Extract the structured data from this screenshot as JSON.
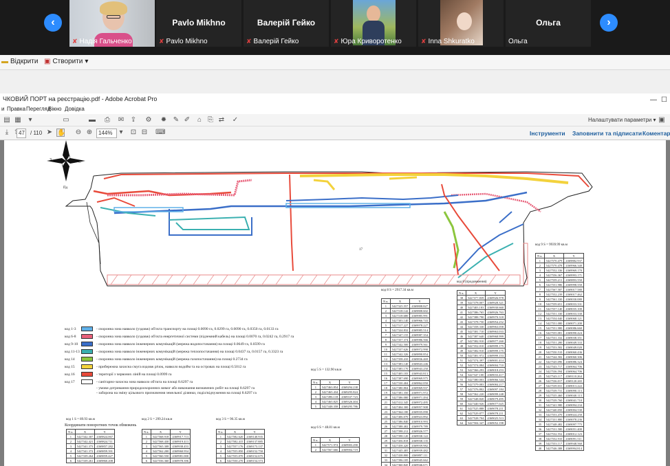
{
  "conference": {
    "participants": [
      {
        "name": "Надія Гальченко",
        "has_video": true
      },
      {
        "name": "Pavlo Mikhno",
        "has_video": false
      },
      {
        "name": "Валерій Гейко",
        "has_video": false
      },
      {
        "name": "Юра Криворотенко",
        "has_video": true
      },
      {
        "name": "Inna Shkuratko",
        "has_video": true
      },
      {
        "name": "Ольга",
        "has_video": false
      }
    ],
    "prev_icon": "chevron-left-icon",
    "next_icon": "chevron-right-icon"
  },
  "acrobat": {
    "toolbar": {
      "open_label": "Відкрити",
      "create_label": "Створити"
    },
    "title": "ЧКОВИЙ ПОРТ  на реєстрацію.pdf - Adobe Acrobat Pro",
    "menu": [
      "и",
      "Правка",
      "Перегляд",
      "Вікно",
      "Довідка"
    ],
    "customize_label": "Налаштувати параметри",
    "nav": {
      "current_page": "47",
      "total_pages": "/ 110",
      "zoom": "144%",
      "tools_label": "Інструменти",
      "fill_sign_label": "Заповнити та підписати",
      "comment_label": "Коментар"
    }
  },
  "document": {
    "compass": {
      "north": "",
      "west": "З",
      "east": "С",
      "south": "Пд"
    },
    "main_area_label": "17",
    "legend": [
      {
        "code": "код 1-3",
        "color": "#5fb0e8",
        "text": "- охоронна зона навколо (уздовж) об'єкта транспорту на площі 0.0090 га, 0.0299 га, 0.0090 га, 0.0350 га, 0.0133 га"
      },
      {
        "code": "код 6-8",
        "color": "#e8607a",
        "text": "- охоронна зона навколо (уздовж) об'єкта енергетичної системи (підземний кабель) на площі 0.0070 га, 0.0242 га, 0.2917 га"
      },
      {
        "code": "код 9-10",
        "color": "#3a6ec8",
        "text": "- охоронна зона навколо інженерних комунікацій (мережа водопостачання) на площі 0.0649 га, 0.0599 га"
      },
      {
        "code": "код 11-13",
        "color": "#3ab0b0",
        "text": "- охоронна зона навколо інженерних комунікацій (мережа теплопостачання) на площі 0.0437 га, 0.0157 га, 0.3323 га"
      },
      {
        "code": "код 14",
        "color": "#8cc63e",
        "text": "- охоронна зона навколо інженерних комунікацій (мережа газопостачання) на площі 0.2734 га"
      },
      {
        "code": "код 15",
        "color": "#f3d23c",
        "text": "- прибережна захисна смуга вздовж річок, навколо водойм та на островах на площі 0.5012 га"
      },
      {
        "code": "код 16",
        "color": "#e84a3a",
        "text": "- території з червоних ліній на площі 0.0999 га"
      },
      {
        "code": "код 17",
        "color": "#ffffff",
        "text": "- санітарно-захисна зона навколо об'єкта на площі 8.6297 га"
      }
    ],
    "legend_notes": [
      "- умови дотримання природоохоронних вимог або виконання визначених робіт на площі 8.6297 га",
      "- заборона на зміну цільового призначення земельної ділянки, поділ/відчуження на площі 8.6297 га"
    ],
    "coord_caption": "Координати поворотних точок обмежень",
    "tables": [
      {
        "title": "код 1",
        "area": "S = 89.93 кв.м",
        "cols": [
          "N к.",
          "X",
          "Y"
        ],
        "rows": [
          [
            "1",
            "5427342.307",
            "4369824.067"
          ],
          [
            "2",
            "5427342.421",
            "4369824.711"
          ],
          [
            "3",
            "5427341.373",
            "4369857.282"
          ],
          [
            "4",
            "5427341.372",
            "4369859.391"
          ],
          [
            "5",
            "5427339.264",
            "4369859.427"
          ],
          [
            "6",
            "5427339.261",
            "4369860.208"
          ]
        ]
      },
      {
        "title": "код 2",
        "area": "S = 299.24 кв.м",
        "cols": [
          "N к.",
          "X",
          "Y"
        ],
        "rows": [
          [
            "1",
            "5427568.918",
            "4369917.713"
          ],
          [
            "2",
            "5427568.430",
            "4369919.413"
          ],
          [
            "3",
            "5427565.308",
            "4369938.453"
          ],
          [
            "4",
            "5427562.200",
            "4369960.954"
          ],
          [
            "5",
            "5427560.550",
            "4369981.000"
          ],
          [
            "6",
            "5427556.360",
            "4369978.396"
          ]
        ]
      },
      {
        "title": "код 3",
        "area": "S = 90.35 кв.м",
        "cols": [
          "N к.",
          "X",
          "Y"
        ],
        "rows": [
          [
            "1",
            "5427582.620",
            "4369140.935"
          ],
          [
            "2",
            "5427582.415",
            "4369137.885"
          ],
          [
            "3",
            "5427557.176",
            "4369173.137"
          ],
          [
            "4",
            "5427555.850",
            "4369152.750"
          ],
          [
            "5",
            "5427555.070",
            "4369152.675"
          ],
          [
            "6",
            "5427550.270",
            "4369154.373"
          ]
        ]
      },
      {
        "title": "код 5",
        "area": "S = 132.90 кв.м",
        "cols": [
          "N к.",
          "X",
          "Y"
        ],
        "rows": [
          [
            "1",
            "5427463.854",
            "4369294.238"
          ],
          [
            "2",
            "5427465.434",
            "4369295.824"
          ],
          [
            "3",
            "5427496.118",
            "4369337.723"
          ],
          [
            "4",
            "5427465.825",
            "4369326.404"
          ],
          [
            "5",
            "5427448.358",
            "4369295.786"
          ]
        ]
      },
      {
        "title": "код 6",
        "area": "S = 48.81 кв.м",
        "cols": [
          "N к.",
          "X",
          "Y"
        ],
        "rows": [
          [
            "1",
            "5427571.974",
            "4369903.290"
          ],
          [
            "2",
            "5427567.666",
            "4369904.719"
          ]
        ]
      },
      {
        "title": "код 8",
        "area": "S = 2917.34 кв.м",
        "cols": [
          "N к.",
          "X",
          "Y"
        ],
        "rows": [
          [
            "1",
            "5427325.557",
            "4369808.827"
          ],
          [
            "2",
            "5427318.142",
            "4369808.602"
          ],
          [
            "3",
            "5427318.680",
            "4369985.991"
          ],
          [
            "4",
            "5427303.140",
            "4369966.743"
          ],
          [
            "5",
            "5427317.227",
            "4369978.227"
          ],
          [
            "6",
            "5427324.832",
            "4369985.514"
          ],
          [
            "7",
            "5427347.155",
            "4369987.354"
          ],
          [
            "8",
            "5427357.374",
            "4369986.566"
          ],
          [
            "9",
            "5427342.500",
            "4369979.561"
          ],
          [
            "10",
            "5427337.626",
            "4369972.990"
          ],
          [
            "11",
            "5427342.326",
            "4369890.854"
          ],
          [
            "12",
            "5427358.410",
            "4369836.469"
          ],
          [
            "13",
            "5427383.140",
            "4369843.246"
          ],
          [
            "14",
            "5427385.170",
            "4369943.250"
          ],
          [
            "15",
            "5427405.183",
            "4369943.813"
          ],
          [
            "16",
            "5427387.690",
            "4369969.975"
          ],
          [
            "17",
            "5427330.404",
            "4369862.050"
          ],
          [
            "18",
            "5427380.804",
            "4369969.937"
          ],
          [
            "19",
            "5427381.350",
            "4369971.972"
          ],
          [
            "20",
            "5427386.080",
            "4369971.494"
          ],
          [
            "21",
            "5427412.345",
            "4369972.495"
          ],
          [
            "22",
            "5427404.300",
            "4369957.908"
          ],
          [
            "23",
            "5427364.180",
            "4369935.090"
          ],
          [
            "24",
            "5427406.070",
            "4369923.892"
          ],
          [
            "25",
            "5427386.840",
            "4369910.993"
          ],
          [
            "26",
            "5427388.402",
            "4369979.789"
          ],
          [
            "27",
            "5427398.212",
            "4369926.577"
          ],
          [
            "28",
            "5427398.120",
            "4369938.122"
          ],
          [
            "29",
            "5427456.818",
            "4369938.135"
          ],
          [
            "30",
            "5427458.420",
            "4369939.982"
          ],
          [
            "31",
            "5427445.405",
            "4369939.482"
          ],
          [
            "32",
            "5427438.800",
            "4369897.111"
          ],
          [
            "33",
            "5427396.185",
            "4369945.662"
          ],
          [
            "34",
            "5427360.845",
            "4369946.671"
          ],
          [
            "35",
            "5427367.147",
            "4369924.713"
          ],
          [
            "36",
            "5427347.352",
            "4369951.147"
          ],
          [
            "37",
            "5427343.352",
            "4369972.978"
          ]
        ]
      },
      {
        "title": "код 8 (продовження)",
        "area": "",
        "cols": [
          "N к.",
          "X",
          "Y"
        ],
        "rows": [
          [
            "38",
            "5427377.839",
            "4369926.978"
          ],
          [
            "39",
            "5427378.007",
            "4369928.321"
          ],
          [
            "40",
            "5427403.183",
            "4369930.660"
          ],
          [
            "41",
            "5427386.765",
            "4369926.763"
          ],
          [
            "42",
            "5427388.790",
            "4369970.318"
          ],
          [
            "43",
            "5427378.750",
            "4369954.252"
          ],
          [
            "44",
            "5427358.330",
            "4369963.058"
          ],
          [
            "45",
            "5427381.710",
            "4369963.033"
          ],
          [
            "46",
            "5427387.640",
            "4369968.999"
          ],
          [
            "47",
            "5427382.910",
            "4369977.260"
          ],
          [
            "48",
            "5427352.010",
            "4369999.175"
          ],
          [
            "49",
            "5427382.910",
            "4369999.175"
          ],
          [
            "50",
            "5427381.972",
            "4369999.153"
          ],
          [
            "51",
            "5427374.397",
            "4369001.414"
          ],
          [
            "52",
            "5427374.084",
            "4369004.710"
          ],
          [
            "53",
            "5427366.293",
            "4369018.253"
          ],
          [
            "54",
            "5427347.100",
            "4369033.417"
          ],
          [
            "55",
            "5427380.003",
            "4369066.344"
          ],
          [
            "56",
            "5427379.083",
            "4369084.217"
          ],
          [
            "57",
            "5427376.802",
            "4369097.184"
          ],
          [
            "58",
            "5427362.220",
            "4369099.248"
          ],
          [
            "59",
            "5427348.820",
            "4369079.495"
          ],
          [
            "60",
            "5427440.926",
            "4369077.025"
          ],
          [
            "61",
            "5427525.888",
            "4369078.211"
          ],
          [
            "62",
            "5427529.877",
            "4369078.211"
          ],
          [
            "63",
            "5427528.704",
            "4369025.513"
          ],
          [
            "64",
            "5427504.347",
            "4369052.198"
          ]
        ]
      },
      {
        "title": "код 9",
        "area": "S = 9939.99 кв.м",
        "cols": [
          "N к.",
          "X",
          "Y"
        ],
        "rows": [
          [
            "1",
            "5427570.479",
            "4369882.937"
          ],
          [
            "2",
            "5427570.478",
            "4369966.340"
          ],
          [
            "3",
            "5427552.336",
            "4369969.170"
          ],
          [
            "4",
            "5427556.367",
            "4369993.171"
          ],
          [
            "5",
            "5427559.211",
            "4369893.550"
          ],
          [
            "6",
            "5427551.986",
            "4369998.550"
          ],
          [
            "7",
            "5427567.587",
            "4369017.580"
          ],
          [
            "8",
            "5427552.239",
            "4369017.462"
          ],
          [
            "9",
            "5427561.330",
            "4369030.080"
          ],
          [
            "10",
            "5427559.651",
            "4369033.331"
          ],
          [
            "11",
            "5427557.140",
            "4369035.100"
          ],
          [
            "12",
            "5427551.330",
            "4369033.330"
          ],
          [
            "13",
            "5427554.040",
            "4369068.121"
          ],
          [
            "14",
            "5427551.080",
            "4369071.200"
          ],
          [
            "15",
            "5427551.980",
            "4369086.660"
          ],
          [
            "16",
            "5427555.081",
            "4369090.424"
          ],
          [
            "17",
            "5427531.332",
            "4369038.351"
          ],
          [
            "18",
            "5427551.280",
            "4369049.333"
          ],
          [
            "19",
            "5427553.582",
            "4369049.020"
          ],
          [
            "20",
            "5427550.510",
            "4369060.436"
          ],
          [
            "21",
            "5427544.582",
            "4369060.306"
          ],
          [
            "22",
            "5427545.096",
            "4369086.324"
          ],
          [
            "23",
            "5427543.717",
            "4369064.706"
          ],
          [
            "24",
            "5427536.594",
            "4369064.706"
          ],
          [
            "25",
            "5427543.117",
            "4369110.264"
          ],
          [
            "26",
            "5427536.017",
            "4369120.265"
          ],
          [
            "27",
            "5427539.031",
            "4369013.222"
          ],
          [
            "28",
            "5427539.731",
            "4369090.113"
          ],
          [
            "29",
            "5427535.460",
            "4369040.113"
          ],
          [
            "30",
            "5427539.760",
            "4369041.710"
          ],
          [
            "31",
            "5427341.980",
            "4369094.234"
          ],
          [
            "32",
            "5427340.050",
            "4369004.530"
          ],
          [
            "33",
            "5427553.470",
            "4369024.250"
          ],
          [
            "34",
            "5427331.880",
            "4369078.236"
          ],
          [
            "35",
            "5427348.482",
            "4369097.775"
          ],
          [
            "36",
            "5427531.580",
            "4369051.400"
          ],
          [
            "37",
            "5427532.552",
            "4369012.123"
          ],
          [
            "38",
            "5427552.910",
            "4369091.511"
          ],
          [
            "39",
            "5427553.117",
            "4369948.560"
          ],
          [
            "40",
            "5427546.388",
            "4369994.814"
          ]
        ]
      }
    ]
  }
}
